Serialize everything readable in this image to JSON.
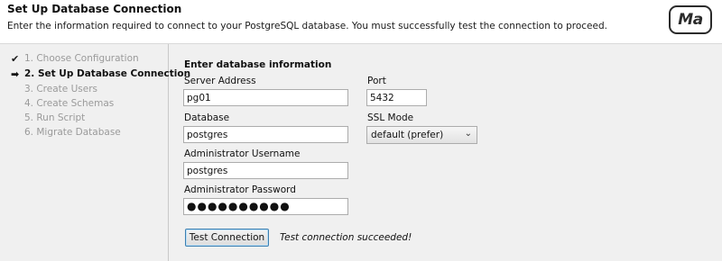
{
  "header": {
    "title": "Set Up Database Connection",
    "description": "Enter the information required to connect to your PostgreSQL database. You must successfully test the connection to proceed.",
    "logo_text": "Ma"
  },
  "steps": [
    {
      "label": "1. Choose Configuration",
      "state": "done",
      "mark": "✔"
    },
    {
      "label": "2. Set Up Database Connection",
      "state": "current",
      "mark": "➡"
    },
    {
      "label": "3. Create Users",
      "state": "pending",
      "mark": ""
    },
    {
      "label": "4. Create Schemas",
      "state": "pending",
      "mark": ""
    },
    {
      "label": "5. Run Script",
      "state": "pending",
      "mark": ""
    },
    {
      "label": "6. Migrate Database",
      "state": "pending",
      "mark": ""
    }
  ],
  "form": {
    "section_title": "Enter database information",
    "server_address": {
      "label": "Server Address",
      "value": "pg01"
    },
    "port": {
      "label": "Port",
      "value": "5432"
    },
    "database": {
      "label": "Database",
      "value": "postgres"
    },
    "ssl_mode": {
      "label": "SSL Mode",
      "value": "default (prefer)"
    },
    "admin_username": {
      "label": "Administrator Username",
      "value": "postgres"
    },
    "admin_password": {
      "label": "Administrator Password",
      "value": "●●●●●●●●●●"
    },
    "test_button": "Test Connection",
    "test_result": "Test connection succeeded!"
  },
  "colors": {
    "sidebar_bg": "#f0f0f0",
    "button_focus_border": "#3c7fb1"
  }
}
